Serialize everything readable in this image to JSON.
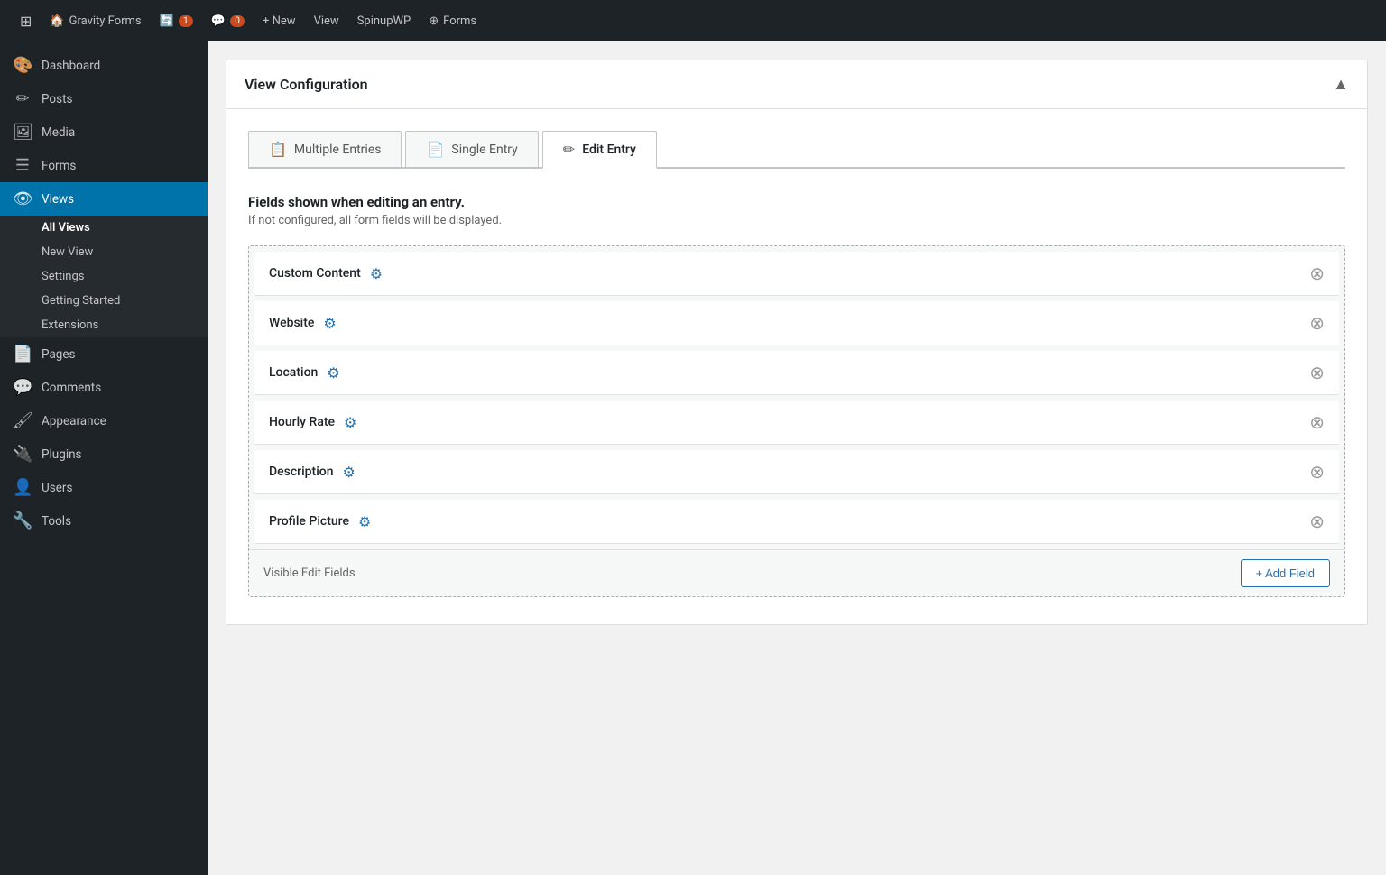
{
  "adminbar": {
    "wp_icon": "⊞",
    "site_name": "Gravity Forms",
    "updates_count": "1",
    "comments_count": "0",
    "new_label": "+ New",
    "view_label": "View",
    "spinupwp_label": "SpinupWP",
    "forms_label": "Forms"
  },
  "sidebar": {
    "items": [
      {
        "id": "dashboard",
        "label": "Dashboard",
        "icon": "🎨"
      },
      {
        "id": "posts",
        "label": "Posts",
        "icon": "✏"
      },
      {
        "id": "media",
        "label": "Media",
        "icon": "🖼"
      },
      {
        "id": "forms",
        "label": "Forms",
        "icon": "☰"
      },
      {
        "id": "views",
        "label": "Views",
        "icon": "👁",
        "active": true
      },
      {
        "id": "pages",
        "label": "Pages",
        "icon": "📄"
      },
      {
        "id": "comments",
        "label": "Comments",
        "icon": "💬"
      },
      {
        "id": "appearance",
        "label": "Appearance",
        "icon": "🖌"
      },
      {
        "id": "plugins",
        "label": "Plugins",
        "icon": "🔌"
      },
      {
        "id": "users",
        "label": "Users",
        "icon": "👤"
      },
      {
        "id": "tools",
        "label": "Tools",
        "icon": "🔧"
      }
    ],
    "submenu": {
      "parent": "views",
      "items": [
        {
          "id": "all-views",
          "label": "All Views",
          "active": true
        },
        {
          "id": "new-view",
          "label": "New View"
        },
        {
          "id": "settings",
          "label": "Settings"
        },
        {
          "id": "getting-started",
          "label": "Getting Started"
        },
        {
          "id": "extensions",
          "label": "Extensions"
        }
      ]
    }
  },
  "panel": {
    "title": "View Configuration",
    "toggle_icon": "▲"
  },
  "tabs": [
    {
      "id": "multiple-entries",
      "label": "Multiple Entries",
      "icon": "📋",
      "active": false
    },
    {
      "id": "single-entry",
      "label": "Single Entry",
      "icon": "📄",
      "active": false
    },
    {
      "id": "edit-entry",
      "label": "Edit Entry",
      "icon": "✏",
      "active": true
    }
  ],
  "fields_section": {
    "heading": "Fields shown when editing an entry.",
    "description": "If not configured, all form fields will be displayed.",
    "fields": [
      {
        "id": "custom-content",
        "label": "Custom Content"
      },
      {
        "id": "website",
        "label": "Website"
      },
      {
        "id": "location",
        "label": "Location"
      },
      {
        "id": "hourly-rate",
        "label": "Hourly Rate"
      },
      {
        "id": "description",
        "label": "Description"
      },
      {
        "id": "profile-picture",
        "label": "Profile Picture"
      }
    ],
    "footer_label": "Visible Edit Fields",
    "add_field_label": "+ Add Field"
  }
}
